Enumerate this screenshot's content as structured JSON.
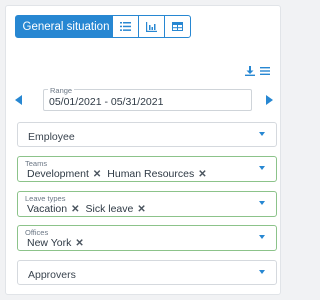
{
  "toolbar": {
    "active_label": "General situation",
    "icons": [
      "bar-chart-icon",
      "list-icon",
      "line-chart-icon",
      "table-icon"
    ]
  },
  "range": {
    "label": "Range",
    "value": "05/01/2021 - 05/31/2021"
  },
  "filters": {
    "employee": {
      "placeholder": "Employee"
    },
    "teams": {
      "label": "Teams",
      "chips": [
        "Development",
        "Human Resources"
      ]
    },
    "leave_types": {
      "label": "Leave types",
      "chips": [
        "Vacation",
        "Sick leave"
      ]
    },
    "offices": {
      "label": "Offices",
      "chips": [
        "New York"
      ]
    },
    "approvers": {
      "placeholder": "Approvers"
    }
  },
  "colors": {
    "accent": "#2787d2",
    "selected_border": "#8cc38a"
  }
}
